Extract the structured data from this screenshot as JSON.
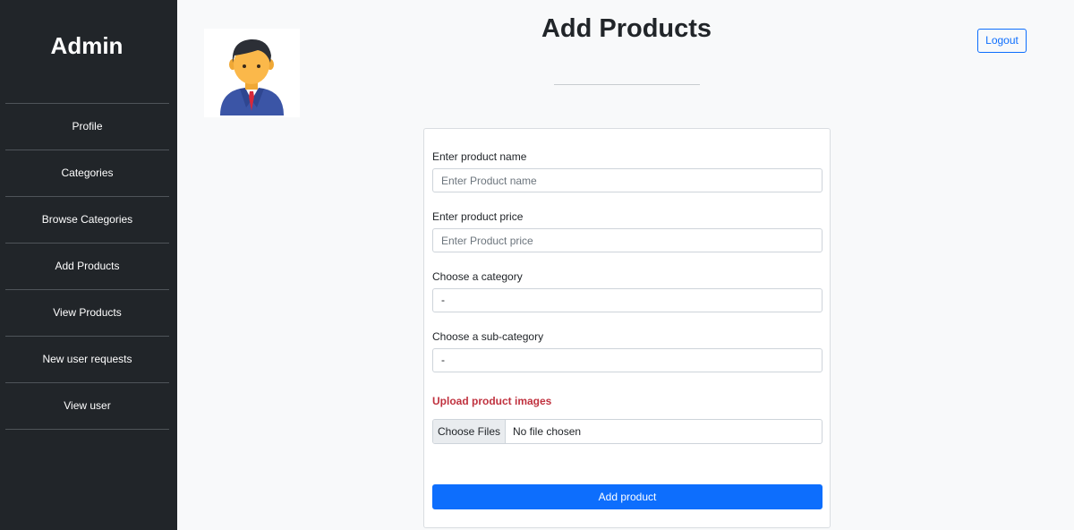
{
  "sidebar": {
    "brand": "Admin",
    "items": [
      {
        "label": "Profile"
      },
      {
        "label": "Categories"
      },
      {
        "label": "Browse Categories"
      },
      {
        "label": "Add Products"
      },
      {
        "label": "View Products"
      },
      {
        "label": "New user requests"
      },
      {
        "label": "View user"
      }
    ]
  },
  "header": {
    "title": "Add Products",
    "logout_label": "Logout",
    "avatar_icon": "user-avatar-icon"
  },
  "form": {
    "name_label": "Enter product name",
    "name_placeholder": "Enter Product name",
    "name_value": "",
    "price_label": "Enter product price",
    "price_placeholder": "Enter Product price",
    "price_value": "",
    "category_label": "Choose a category",
    "category_value": "-",
    "subcategory_label": "Choose a sub-category",
    "subcategory_value": "-",
    "upload_label": "Upload product images",
    "file_button": "Choose Files",
    "file_status": "No file chosen",
    "submit_label": "Add product"
  },
  "colors": {
    "sidebar_bg": "#212529",
    "primary": "#0d6efd",
    "upload_label": "#c0323f",
    "page_bg": "#f8f9fa"
  }
}
